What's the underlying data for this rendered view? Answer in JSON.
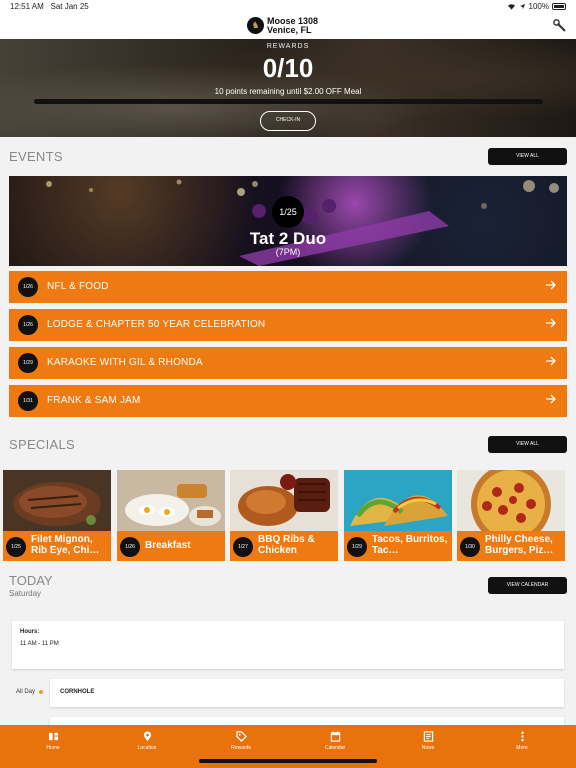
{
  "status": {
    "time": "12:51 AM",
    "date": "Sat Jan 25",
    "battery": "100%"
  },
  "header": {
    "lodge_name": "Moose 1308",
    "location": "Venice, FL"
  },
  "rewards": {
    "label": "REWARDS",
    "points": "0/10",
    "note": "10 points remaining until $2.00 OFF Meal",
    "progress_fraction": 0.0,
    "checkin_label": "CHECK-IN"
  },
  "events": {
    "title": "EVENTS",
    "view_all": "VIEW ALL",
    "featured": {
      "date": "1/25",
      "name": "Tat 2 Duo",
      "time": "(7PM)"
    },
    "items": [
      {
        "date": "1/26",
        "name": "NFL & FOOD"
      },
      {
        "date": "1/26",
        "name": "LODGE & CHAPTER 50 YEAR CELEBRATION"
      },
      {
        "date": "1/29",
        "name": "KARAOKE WITH GIL & RHONDA"
      },
      {
        "date": "1/31",
        "name": "FRANK & SAM JAM"
      }
    ]
  },
  "specials": {
    "title": "SPECIALS",
    "view_all": "VIEW ALL",
    "items": [
      {
        "date": "1/25",
        "name": "Filet Mignon, Rib Eye, Chi…"
      },
      {
        "date": "1/26",
        "name": "Breakfast"
      },
      {
        "date": "1/27",
        "name": "BBQ Ribs & Chicken"
      },
      {
        "date": "1/29",
        "name": "Tacos, Burritos, Tac…"
      },
      {
        "date": "1/30",
        "name": "Philly Cheese, Burgers, Piz…"
      }
    ]
  },
  "today": {
    "title": "TODAY",
    "day": "Saturday",
    "view_calendar": "VIEW CALENDAR",
    "hours_label": "Hours:",
    "hours_value": "11 AM - 11 PM",
    "all_day_label": "All Day",
    "all_day_event": "CORNHOLE"
  },
  "tabs": [
    {
      "label": "Home",
      "icon": "home-icon"
    },
    {
      "label": "Location",
      "icon": "location-pin-icon"
    },
    {
      "label": "Rewards",
      "icon": "rewards-tag-icon"
    },
    {
      "label": "Calendar",
      "icon": "calendar-icon"
    },
    {
      "label": "News",
      "icon": "news-icon"
    },
    {
      "label": "More",
      "icon": "more-icon"
    }
  ],
  "colors": {
    "accent": "#f07a12",
    "tabbar": "#e8720c",
    "dark": "#111111"
  }
}
